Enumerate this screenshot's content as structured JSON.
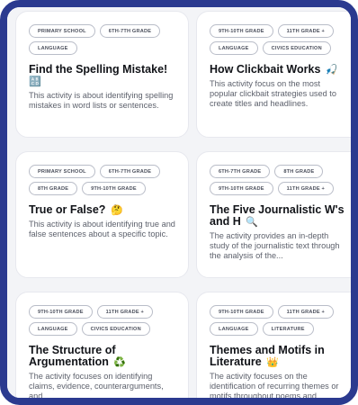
{
  "cards": [
    {
      "tags": [
        "PRIMARY SCHOOL",
        "6TH-7TH GRADE",
        "LANGUAGE"
      ],
      "title": "Find the Spelling Mistake!",
      "emoji": "🔠",
      "description": "This activity is about identifying spelling mistakes in word lists or sentences."
    },
    {
      "tags": [
        "9TH-10TH GRADE",
        "11TH GRADE +",
        "LANGUAGE",
        "CIVICS EDUCATION"
      ],
      "title": "How Clickbait Works",
      "emoji": "🎣",
      "description": "This activity focus on the most popular clickbait strategies used to create titles and headlines."
    },
    {
      "tags": [
        "PRIMARY SCHOOL",
        "6TH-7TH GRADE",
        "8TH GRADE",
        "9TH-10TH GRADE"
      ],
      "title": "True or False?",
      "emoji": "🤔",
      "description": "This activity is about identifying true and false sentences about a specific topic."
    },
    {
      "tags": [
        "6TH-7TH GRADE",
        "8TH GRADE",
        "9TH-10TH GRADE",
        "11TH GRADE +"
      ],
      "title": "The Five Journalistic W's and H",
      "emoji": "🔍",
      "description": "The activity provides an in-depth study of the journalistic text through the analysis of the..."
    },
    {
      "tags": [
        "9TH-10TH GRADE",
        "11TH GRADE +",
        "LANGUAGE",
        "CIVICS EDUCATION"
      ],
      "title": "The Structure of Argumentation",
      "emoji": "♻️",
      "description": "The activity focuses on identifying claims, evidence, counterarguments, and..."
    },
    {
      "tags": [
        "9TH-10TH GRADE",
        "11TH GRADE +",
        "LANGUAGE",
        "LITERATURE"
      ],
      "title": "Themes and Motifs in Literature",
      "emoji": "👑",
      "description": "The activity focuses on the identification of recurring themes or motifs throughout poems and..."
    }
  ]
}
